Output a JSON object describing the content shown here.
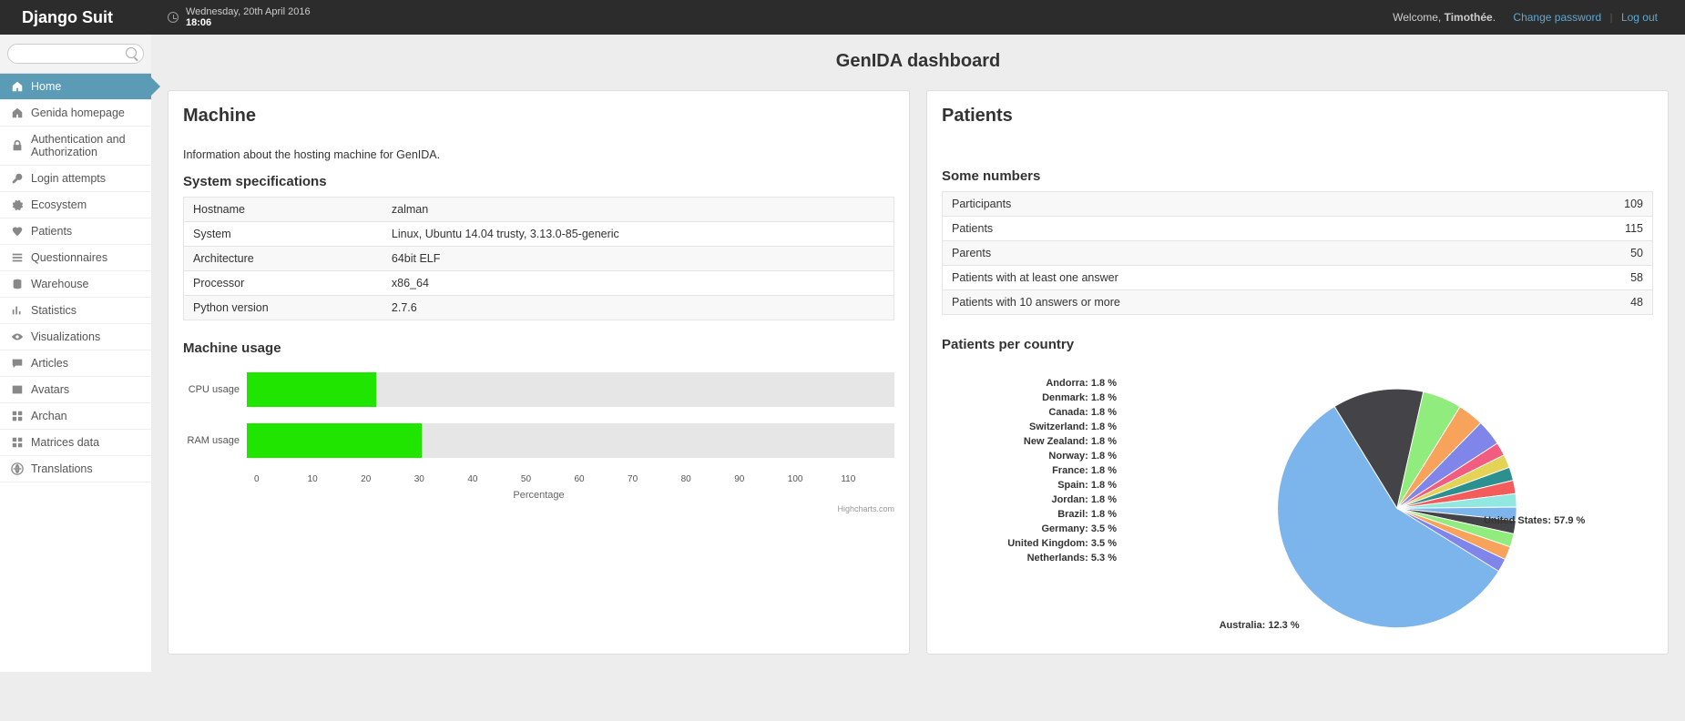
{
  "brand": "Django Suit",
  "datetime": {
    "date": "Wednesday, 20th April 2016",
    "time": "18:06"
  },
  "user": {
    "welcome": "Welcome,",
    "name": "Timothée",
    "change_pw": "Change password",
    "logout": "Log out"
  },
  "sidebar": {
    "items": [
      {
        "label": "Home",
        "icon": "home-icon"
      },
      {
        "label": "Genida homepage",
        "icon": "home-icon"
      },
      {
        "label": "Authentication and Authorization",
        "icon": "lock-icon"
      },
      {
        "label": "Login attempts",
        "icon": "key-icon"
      },
      {
        "label": "Ecosystem",
        "icon": "cog-icon"
      },
      {
        "label": "Patients",
        "icon": "heart-icon"
      },
      {
        "label": "Questionnaires",
        "icon": "list-icon"
      },
      {
        "label": "Warehouse",
        "icon": "db-icon"
      },
      {
        "label": "Statistics",
        "icon": "bars-icon"
      },
      {
        "label": "Visualizations",
        "icon": "eye-icon"
      },
      {
        "label": "Articles",
        "icon": "chat-icon"
      },
      {
        "label": "Avatars",
        "icon": "image-icon"
      },
      {
        "label": "Archan",
        "icon": "grid-icon"
      },
      {
        "label": "Matrices data",
        "icon": "grid-icon"
      },
      {
        "label": "Translations",
        "icon": "globe-icon"
      }
    ]
  },
  "page_title": "GenIDA dashboard",
  "machine": {
    "title": "Machine",
    "info": "Information about the hosting machine for GenIDA.",
    "spec_title": "System specifications",
    "specs": [
      {
        "k": "Hostname",
        "v": "zalman"
      },
      {
        "k": "System",
        "v": "Linux, Ubuntu 14.04 trusty, 3.13.0-85-generic"
      },
      {
        "k": "Architecture",
        "v": "64bit ELF"
      },
      {
        "k": "Processor",
        "v": "x86_64"
      },
      {
        "k": "Python version",
        "v": "2.7.6"
      }
    ],
    "usage_title": "Machine usage",
    "axis_label": "Percentage",
    "credit": "Highcharts.com"
  },
  "patients": {
    "title": "Patients",
    "numbers_title": "Some numbers",
    "numbers": [
      {
        "k": "Participants",
        "v": "109"
      },
      {
        "k": "Patients",
        "v": "115"
      },
      {
        "k": "Parents",
        "v": "50"
      },
      {
        "k": "Patients with at least one answer",
        "v": "58"
      },
      {
        "k": "Patients with 10 answers or more",
        "v": "48"
      }
    ],
    "pie_title": "Patients per country"
  },
  "chart_data": [
    {
      "type": "bar",
      "orientation": "horizontal",
      "title": "Machine usage",
      "xlabel": "Percentage",
      "xlim": [
        0,
        110
      ],
      "ticks": [
        0,
        10,
        20,
        30,
        40,
        50,
        60,
        70,
        80,
        90,
        100,
        110
      ],
      "categories": [
        "CPU usage",
        "RAM usage"
      ],
      "values": [
        20,
        27
      ]
    },
    {
      "type": "pie",
      "title": "Patients per country",
      "series": [
        {
          "name": "United States",
          "value": 57.9,
          "color": "#7cb5ec"
        },
        {
          "name": "Australia",
          "value": 12.3,
          "color": "#434348"
        },
        {
          "name": "Netherlands",
          "value": 5.3,
          "color": "#90ed7d"
        },
        {
          "name": "United Kingdom",
          "value": 3.5,
          "color": "#f7a35c"
        },
        {
          "name": "Germany",
          "value": 3.5,
          "color": "#8085e9"
        },
        {
          "name": "Brazil",
          "value": 1.8,
          "color": "#f15c80"
        },
        {
          "name": "Jordan",
          "value": 1.8,
          "color": "#e4d354"
        },
        {
          "name": "Spain",
          "value": 1.8,
          "color": "#2b908f"
        },
        {
          "name": "France",
          "value": 1.8,
          "color": "#f45b5b"
        },
        {
          "name": "Norway",
          "value": 1.8,
          "color": "#91e8e1"
        },
        {
          "name": "New Zealand",
          "value": 1.8,
          "color": "#7cb5ec"
        },
        {
          "name": "Switzerland",
          "value": 1.8,
          "color": "#434348"
        },
        {
          "name": "Canada",
          "value": 1.8,
          "color": "#90ed7d"
        },
        {
          "name": "Denmark",
          "value": 1.8,
          "color": "#f7a35c"
        },
        {
          "name": "Andorra",
          "value": 1.8,
          "color": "#8085e9"
        }
      ]
    }
  ]
}
